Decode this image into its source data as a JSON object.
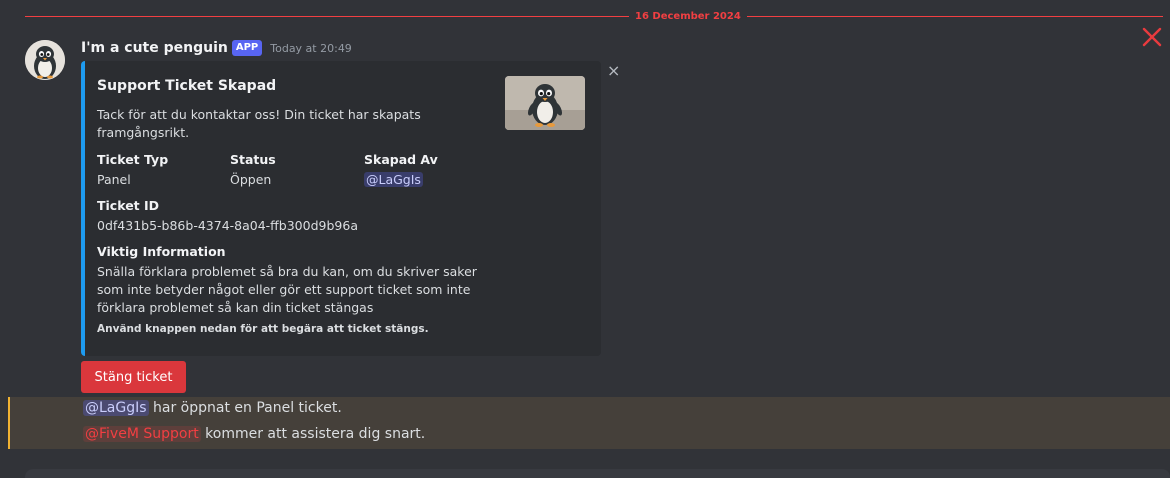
{
  "divider": {
    "date": "16 December 2024"
  },
  "message": {
    "username": "I'm a cute penguin",
    "badge": "APP",
    "timestamp": "Today at 20:49"
  },
  "embed": {
    "title": "Support Ticket Skapad",
    "description": "Tack för att du kontaktar oss! Din ticket har skapats framgångsrikt.",
    "fields": [
      {
        "name": "Ticket Typ",
        "value": "Panel"
      },
      {
        "name": "Status",
        "value": "Öppen"
      },
      {
        "name": "Skapad Av",
        "value": "@LaGgIs"
      },
      {
        "name": "Ticket ID",
        "value": "0df431b5-b86b-4374-8a04-ffb300d9b96a"
      },
      {
        "name": "Viktig Information",
        "value": "Snälla förklara problemet så bra du kan, om du skriver saker som inte betyder något eller gör ett support ticket som inte förklara problemet så kan din ticket stängas"
      }
    ],
    "footer": "Använd knappen nedan för att begära att ticket stängs.",
    "close_glyph": "×"
  },
  "button": {
    "label": "Stäng ticket"
  },
  "followup": {
    "line1_mention": "@LaGgIs",
    "line1_text": " har öppnat en Panel ticket.",
    "line2_mention": "@FiveM Support",
    "line2_text": " kommer att assistera dig snart."
  },
  "colors": {
    "background": "#313338",
    "embed_bg": "#2b2d31",
    "embed_accent": "#1e9bf0",
    "danger": "#da373c",
    "divider": "#f23f42",
    "highlight_bg": "#45403a",
    "highlight_border": "#f0b232",
    "app_badge": "#5865f2"
  }
}
